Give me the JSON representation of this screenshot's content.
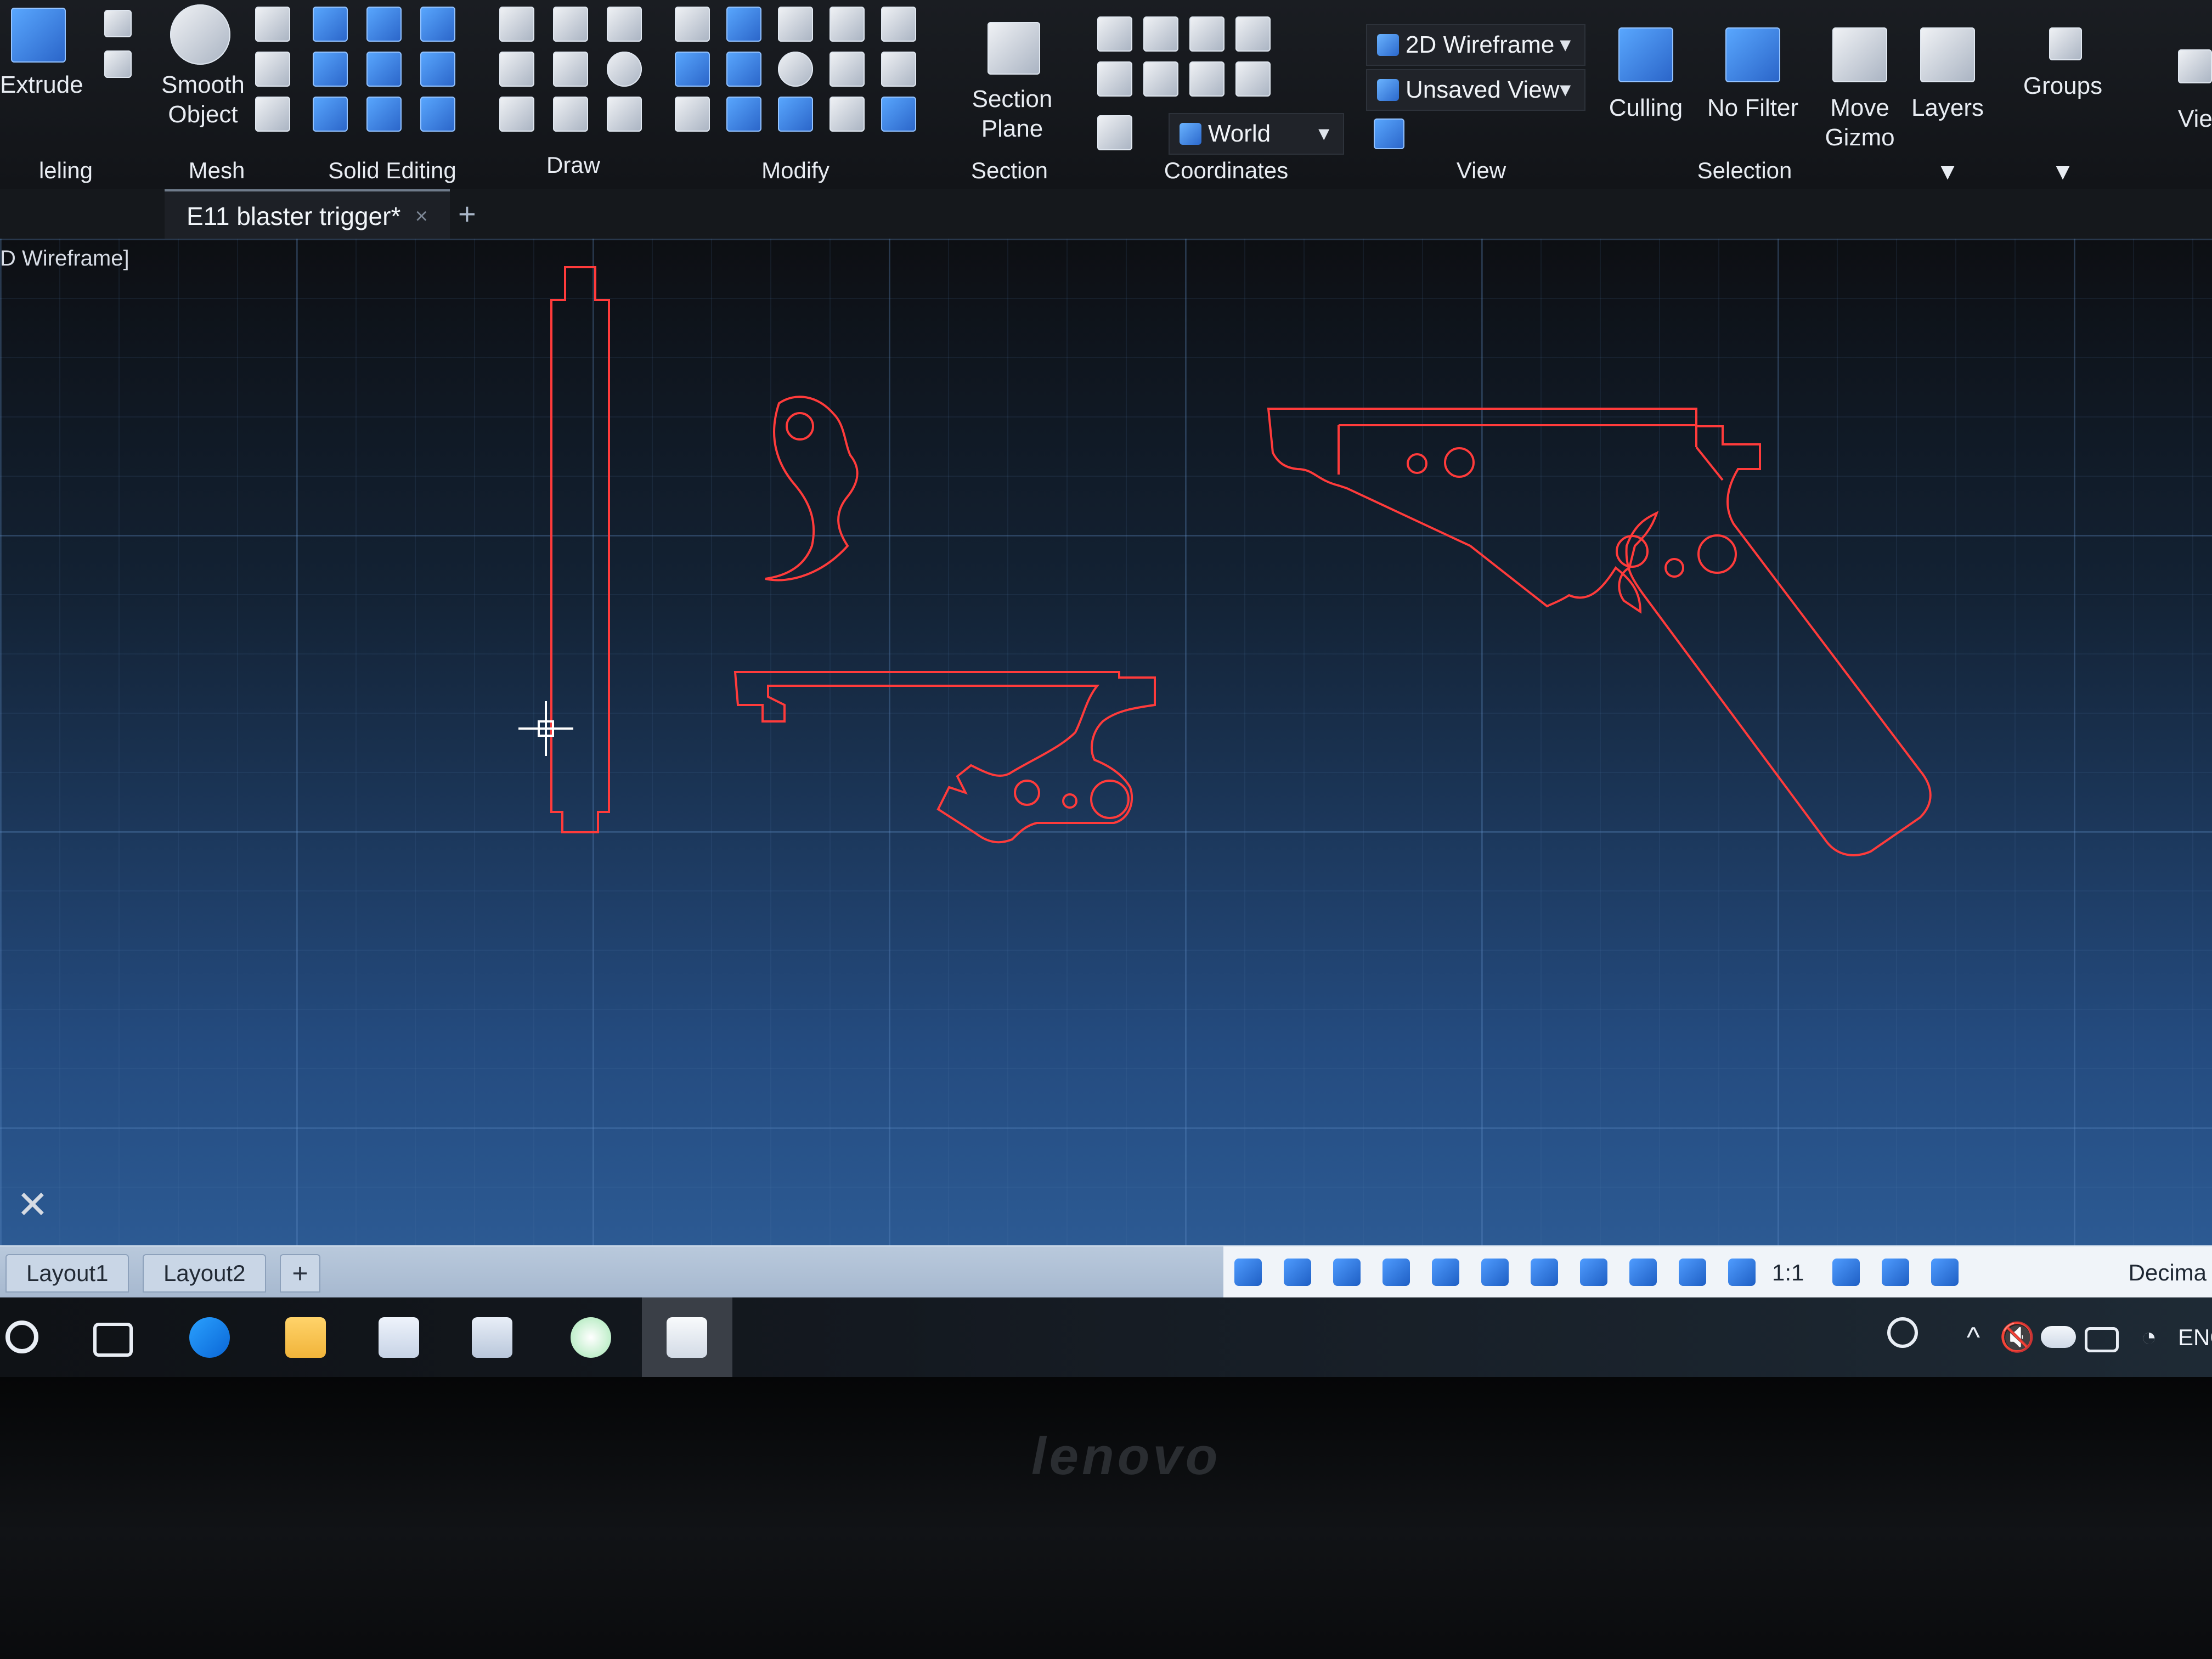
{
  "ribbon": {
    "panels": [
      {
        "id": "modeling",
        "title": "leling",
        "labels": [
          "Extrude"
        ]
      },
      {
        "id": "mesh",
        "title": "Mesh",
        "labels": [
          "Smooth",
          "Object"
        ]
      },
      {
        "id": "solid_editing",
        "title": "Solid Editing"
      },
      {
        "id": "draw",
        "title": "Draw"
      },
      {
        "id": "modify",
        "title": "Modify"
      },
      {
        "id": "section",
        "title": "Section",
        "labels": [
          "Section",
          "Plane"
        ]
      },
      {
        "id": "coordinates",
        "title": "Coordinates",
        "world": "World"
      },
      {
        "id": "view",
        "title": "View",
        "visual_style": "2D Wireframe",
        "saved_view": "Unsaved View"
      },
      {
        "id": "selection",
        "title": "Selection",
        "labels": [
          "Culling",
          "No Filter",
          "Move",
          "Gizmo"
        ]
      },
      {
        "id": "layers",
        "labels": [
          "Layers"
        ]
      },
      {
        "id": "groups",
        "labels": [
          "Groups"
        ]
      },
      {
        "id": "view_partial",
        "labels": [
          "Vie"
        ]
      }
    ]
  },
  "tabs": {
    "document": "E11 blaster trigger*",
    "close_glyph": "×",
    "new_tab_glyph": "+"
  },
  "viewport": {
    "style_label": "D Wireframe]",
    "line_color": "#ff3b3b",
    "close_glyph": "✕"
  },
  "statusbar": {
    "layout_tabs": [
      "Layout1",
      "Layout2"
    ],
    "add_glyph": "+",
    "scale": "1:1",
    "units": "Decima"
  },
  "taskbar": {
    "lang": "ENG"
  },
  "bezel": {
    "brand": "lenovo"
  }
}
